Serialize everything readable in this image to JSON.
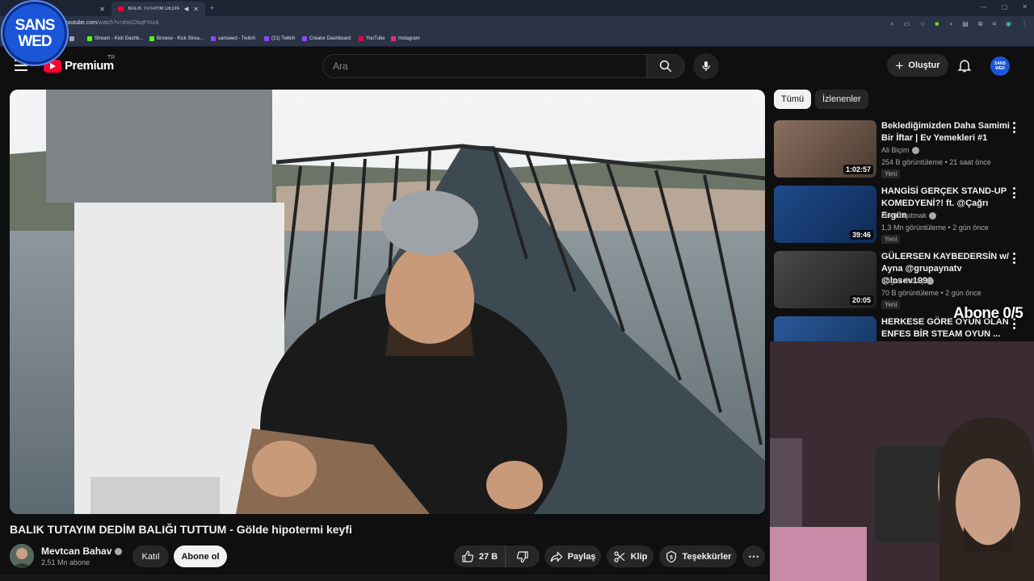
{
  "browser": {
    "tabs": [
      {
        "label": "",
        "active": false
      },
      {
        "label": "BALIK TUTAYIM DEDİM BALIĞ",
        "active": true
      }
    ],
    "url_host": "youtube.com",
    "url_path": "/watch?v=dsKObqPXtzA",
    "bookmarks": [
      {
        "label": "Stream - Kick Dashb...",
        "color": "#53fc18"
      },
      {
        "label": "Browse - Kick Strea...",
        "color": "#53fc18"
      },
      {
        "label": "sanswed - Twitch",
        "color": "#9146ff"
      },
      {
        "label": "(21) Twitch",
        "color": "#9146ff"
      },
      {
        "label": "Creator Dashboard",
        "color": "#9146ff"
      },
      {
        "label": "YouTube",
        "color": "#ff0033"
      },
      {
        "label": "Instagram",
        "color": "#e1306c"
      }
    ]
  },
  "badge": {
    "line1": "SANS",
    "line2": "WED"
  },
  "header": {
    "brand": "Premium",
    "country": "TR",
    "search_placeholder": "Ara",
    "create_label": "Oluştur",
    "avatar_text": "SANS WED"
  },
  "video": {
    "title": "BALIK TUTAYIM DEDİM BALIĞI TUTTUM - Gölde hipotermi keyfi",
    "channel": "Mevtcan Bahav",
    "subscribers": "2,51 Mn abone",
    "join_label": "Katıl",
    "subscribe_label": "Abone ol",
    "likes": "27 B",
    "share_label": "Paylaş",
    "clip_label": "Klip",
    "thanks_label": "Teşekkürler"
  },
  "sidebar": {
    "chips": [
      "Tümü",
      "İzlenenler"
    ],
    "recs": [
      {
        "title": "Beklediğimizden Daha Samimi Bir İftar | Ev Yemekleri #1",
        "channel": "Ali Biçim",
        "meta": "254 B görüntüleme • 21 saat önce",
        "badge": "Yeni",
        "duration": "1:02:57",
        "thumb": "#6b5a4a"
      },
      {
        "title": "HANGİSİ GERÇEK STAND-UP KOMEDYENİ?! ft. @Çağrı Ergün",
        "channel": "Orkun Işıtmak",
        "meta": "1,3 Mn görüntüleme • 2 gün önce",
        "badge": "Yeni",
        "duration": "39:46",
        "thumb": "#1e4a8a"
      },
      {
        "title": "GÜLERSEN KAYBEDERSİN w/ Ayna @grupaynatv @losev1998",
        "channel": "Soğuk Savaş",
        "meta": "70 B görüntüleme • 2 gün önce",
        "badge": "Yeni",
        "duration": "20:05",
        "thumb": "#3a3a3a"
      },
      {
        "title": "HERKESE GÖRE OYUN OLAN ENFES BİR STEAM OYUN ...",
        "channel": "",
        "meta": "",
        "badge": "",
        "duration": "",
        "thumb": "#2a5a9a"
      }
    ]
  },
  "overlay": {
    "subs_goal": "Abone 0/5"
  }
}
